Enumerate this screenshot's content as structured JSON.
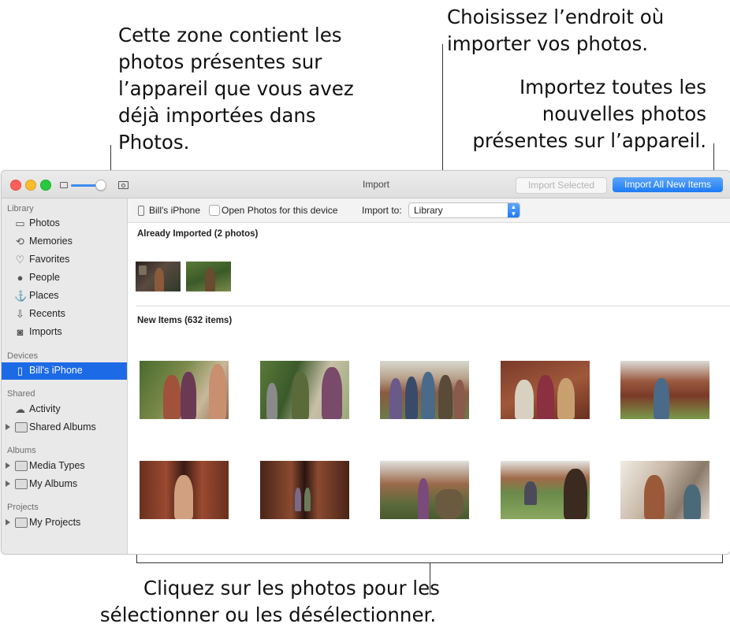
{
  "callouts": {
    "already_imported": [
      "Cette zone contient les",
      "photos présentes sur",
      "l’appareil que vous avez",
      "déjà importées dans",
      "Photos."
    ],
    "import_location": [
      "Choisissez l’endroit où",
      "importer vos photos."
    ],
    "import_all": [
      "Importez toutes les",
      "nouvelles photos",
      "présentes sur l’appareil."
    ],
    "select_photos": [
      "Cliquez sur les photos pour les",
      "sélectionner ou les désélectionner."
    ]
  },
  "window": {
    "title": "Import",
    "import_selected_label": "Import Selected",
    "import_all_label": "Import All New Items"
  },
  "sidebar": {
    "library_header": "Library",
    "library_items": [
      {
        "label": "Photos",
        "icon": "photos-icon"
      },
      {
        "label": "Memories",
        "icon": "memories-icon"
      },
      {
        "label": "Favorites",
        "icon": "heart-icon"
      },
      {
        "label": "People",
        "icon": "person-icon"
      },
      {
        "label": "Places",
        "icon": "pin-icon"
      },
      {
        "label": "Recents",
        "icon": "recents-icon"
      },
      {
        "label": "Imports",
        "icon": "imports-icon"
      }
    ],
    "devices_header": "Devices",
    "device_item": "Bill's iPhone",
    "shared_header": "Shared",
    "shared_items": [
      "Activity",
      "Shared Albums"
    ],
    "albums_header": "Albums",
    "album_items": [
      "Media Types",
      "My Albums"
    ],
    "projects_header": "Projects",
    "project_items": [
      "My Projects"
    ]
  },
  "toolbar": {
    "device_name": "Bill's iPhone",
    "open_photos_label": "Open Photos for this device",
    "open_photos_checked": false,
    "import_to_label": "Import to:",
    "import_to_value": "Library"
  },
  "already_imported": {
    "title": "Already Imported (2 photos)",
    "count": 2
  },
  "new_items": {
    "title": "New Items (632 items)",
    "visible_thumbnails": 10
  },
  "colors": {
    "accent": "#1d7bf5",
    "sidebar_selection": "#1d6ae6"
  }
}
